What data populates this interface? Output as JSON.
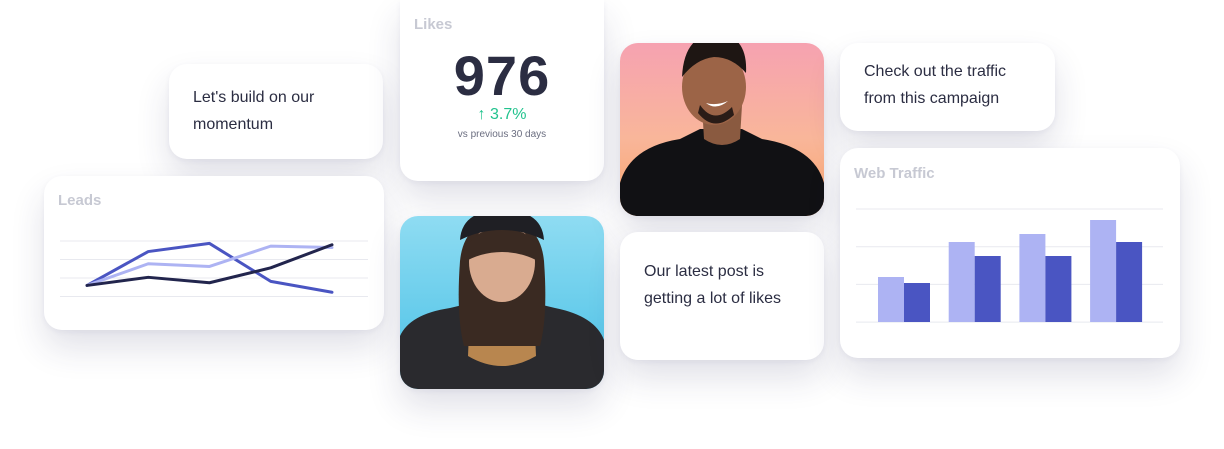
{
  "messages": {
    "build": "Let's build on our momentum",
    "traffic": "Check out the traffic from this campaign",
    "post": "Our latest post is getting a lot of likes"
  },
  "likes": {
    "title": "Likes",
    "value": "976",
    "change_arrow": "↑",
    "change": "3.7%",
    "note": "vs previous 30 days"
  },
  "colors": {
    "dark_navy": "#22254d",
    "indigo": "#4a55c2",
    "periwinkle": "#adb3f3",
    "green": "#22c38e"
  },
  "charts": {
    "leads_title": "Leads",
    "web_title": "Web Traffic"
  },
  "chart_data": [
    {
      "type": "line",
      "title": "Leads",
      "x": [
        1,
        2,
        3,
        4,
        5
      ],
      "series": [
        {
          "values": [
            0,
            12.5,
            15.5,
            1.5,
            -2.5
          ]
        },
        {
          "values": [
            0,
            8,
            7,
            14.5,
            14
          ]
        },
        {
          "values": [
            0,
            3,
            1,
            6.5,
            15
          ]
        }
      ],
      "ylim": [
        -5,
        17.5
      ],
      "grid": true
    },
    {
      "type": "bar",
      "title": "Web Traffic",
      "categories": [
        "1",
        "2",
        "3",
        "4"
      ],
      "series": [
        {
          "values": [
            45,
            80,
            88,
            102
          ]
        },
        {
          "values": [
            39,
            66,
            66,
            80
          ]
        }
      ],
      "ylim": [
        0,
        102
      ],
      "grid": true
    }
  ]
}
